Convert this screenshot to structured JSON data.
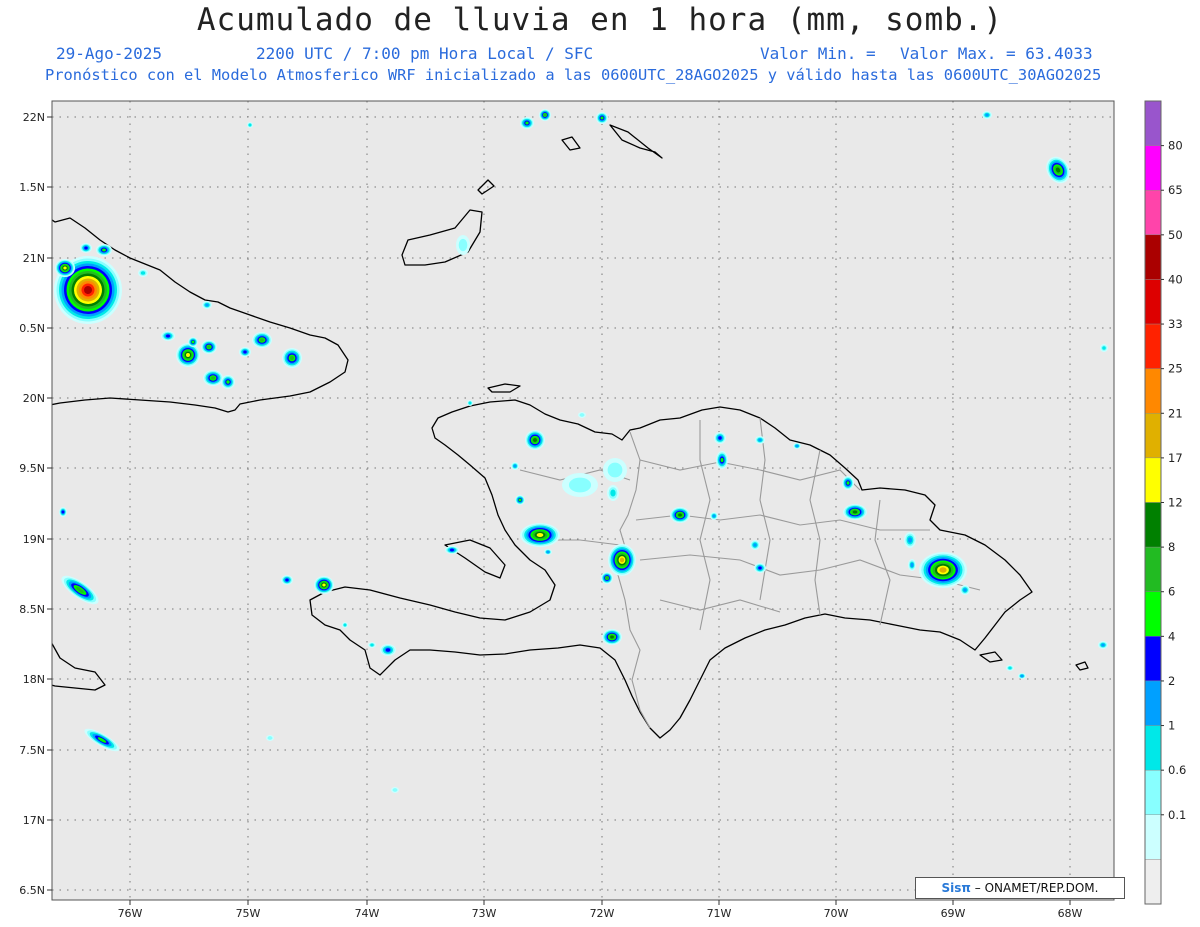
{
  "header": {
    "title": "Acumulado de lluvia en 1 hora (mm, somb.)",
    "date": "29-Ago-2025",
    "time": "2200 UTC / 7:00 pm Hora Local / SFC",
    "min_label": "Valor Min. =",
    "max_label": "Valor Max. = 63.4033",
    "description": "Pronóstico con el Modelo Atmosferico WRF inicializado a las 0600UTC_28AGO2025 y válido hasta las  0600UTC_30AGO2025"
  },
  "axes": {
    "lon_labels": [
      "76W",
      "75W",
      "74W",
      "73W",
      "72W",
      "71W",
      "70W",
      "69W",
      "68W"
    ],
    "lat_labels": [
      "22N",
      "1.5N",
      "21N",
      "0.5N",
      "20N",
      "9.5N",
      "19N",
      "8.5N",
      "18N",
      "7.5N",
      "17N",
      "6.5N"
    ]
  },
  "colorbar": {
    "labels": [
      "80",
      "65",
      "50",
      "40",
      "33",
      "25",
      "21",
      "17",
      "12",
      "8",
      "6",
      "4",
      "2",
      "1",
      "0.6",
      "0.1"
    ],
    "colors": [
      "#9955cc",
      "#ff00ff",
      "#ff44aa",
      "#aa0000",
      "#dd0000",
      "#ff2200",
      "#ff8800",
      "#e0b000",
      "#ffff00",
      "#008000",
      "#22bb22",
      "#00ff00",
      "#0000ff",
      "#00a0ff",
      "#00e8e8",
      "#88ffff",
      "#ccffff",
      "#eeeeee"
    ]
  },
  "credit": {
    "brand": "Sisπ",
    "text": "– ONAMET/REP.DOM."
  },
  "map_colors": {
    "background": "#e9e9e9",
    "coast": "#000000",
    "provinces": "#9a9a9a",
    "grid": "#777777"
  }
}
